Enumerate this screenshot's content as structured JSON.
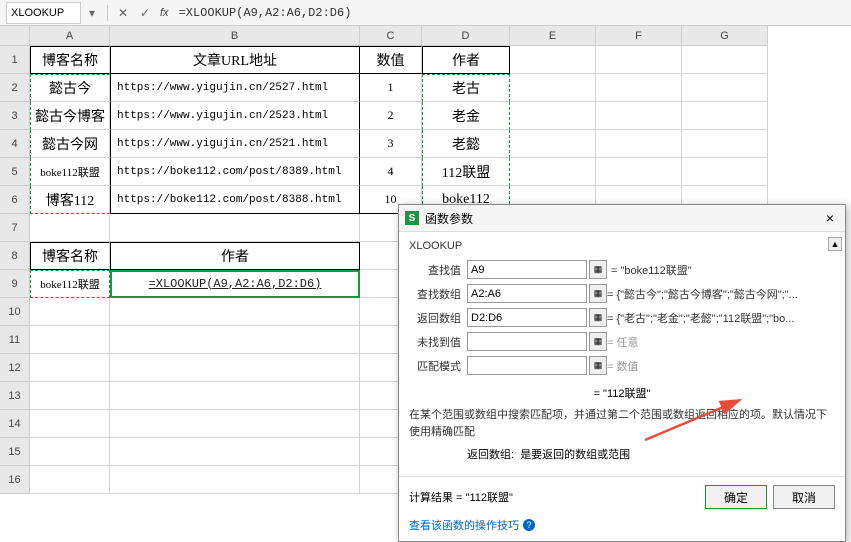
{
  "formula_bar": {
    "name_box": "XLOOKUP",
    "fx": "fx",
    "formula": "=XLOOKUP(A9,A2:A6,D2:D6)"
  },
  "columns": [
    "A",
    "B",
    "C",
    "D",
    "E",
    "F",
    "G"
  ],
  "rows": [
    "1",
    "2",
    "3",
    "4",
    "5",
    "6",
    "7",
    "8",
    "9",
    "10",
    "11",
    "12",
    "13",
    "14",
    "15",
    "16"
  ],
  "grid": {
    "r1": {
      "A": "博客名称",
      "B": "文章URL地址",
      "C": "数值",
      "D": "作者"
    },
    "r2": {
      "A": "懿古今",
      "B": "https://www.yigujin.cn/2527.html",
      "C": "1",
      "D": "老古"
    },
    "r3": {
      "A": "懿古今博客",
      "B": "https://www.yigujin.cn/2523.html",
      "C": "2",
      "D": "老金"
    },
    "r4": {
      "A": "懿古今网",
      "B": "https://www.yigujin.cn/2521.html",
      "C": "3",
      "D": "老懿"
    },
    "r5": {
      "A": "boke112联盟",
      "B": "https://boke112.com/post/8389.html",
      "C": "4",
      "D": "112联盟"
    },
    "r6": {
      "A": "博客112",
      "B": "https://boke112.com/post/8388.html",
      "C": "10",
      "D": "boke112"
    },
    "r8": {
      "A": "博客名称",
      "B": "作者"
    },
    "r9": {
      "A": "boke112联盟",
      "B": "=XLOOKUP(A9,A2:A6,D2:D6)"
    }
  },
  "dialog": {
    "title": "函数参数",
    "func": "XLOOKUP",
    "params": [
      {
        "label": "查找值",
        "value": "A9",
        "result": "= \"boke112联盟\""
      },
      {
        "label": "查找数组",
        "value": "A2:A6",
        "result": "= {\"懿古今\";\"懿古今博客\";\"懿古今网\";\"..."
      },
      {
        "label": "返回数组",
        "value": "D2:D6",
        "result": "= {\"老古\";\"老金\";\"老懿\";\"112联盟\";\"bo..."
      },
      {
        "label": "未找到值",
        "value": "",
        "result": "= 任意"
      },
      {
        "label": "匹配模式",
        "value": "",
        "result": "= 数值"
      }
    ],
    "result_line": "= \"112联盟\"",
    "description": "在某个范围或数组中搜索匹配项，并通过第二个范围或数组返回相应的项。默认情况下使用精确匹配",
    "sub_label": "返回数组:",
    "sub_desc": "是要返回的数组或范围",
    "calc_result_label": "计算结果 =",
    "calc_result": "\"112联盟\"",
    "help": "查看该函数的操作技巧",
    "ok": "确定",
    "cancel": "取消"
  }
}
